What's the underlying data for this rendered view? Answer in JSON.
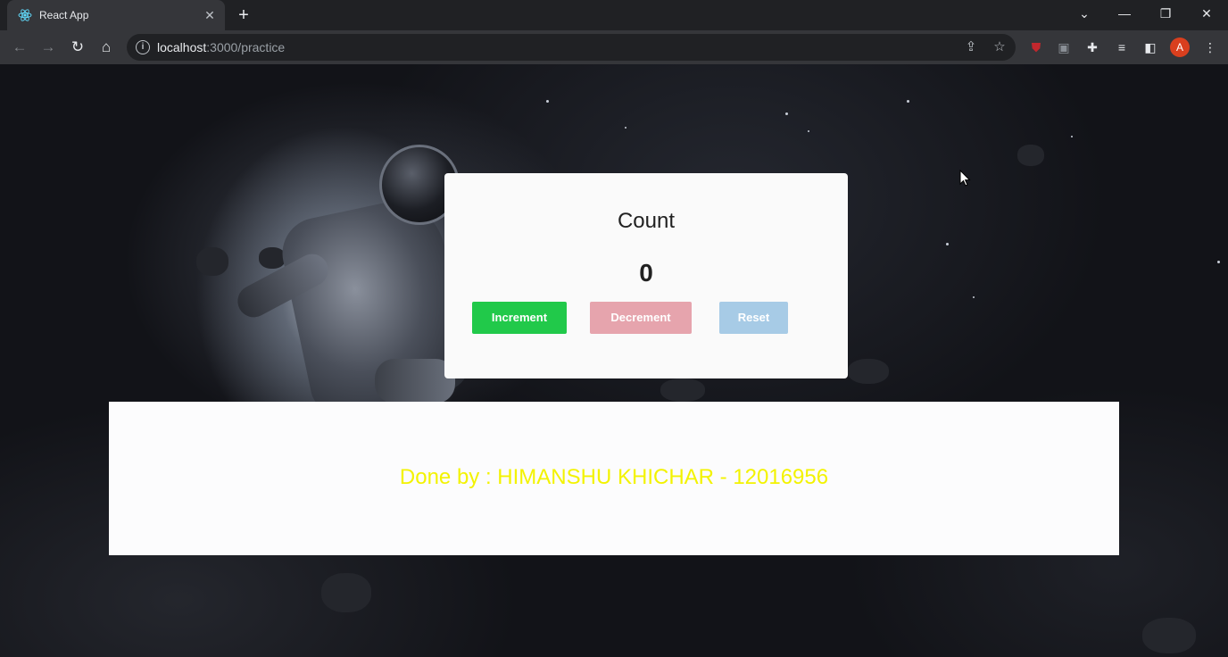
{
  "browser": {
    "tab_title": "React App",
    "tab_close": "✕",
    "new_tab": "+",
    "url_host": "localhost",
    "url_path": ":3000/practice",
    "avatar_letter": "A",
    "window_controls": {
      "minimize": "—",
      "restore": "❐",
      "close": "✕",
      "tab_search": "⌄"
    }
  },
  "counter": {
    "title": "Count",
    "value": "0",
    "buttons": {
      "increment": "Increment",
      "decrement": "Decrement",
      "reset": "Reset"
    }
  },
  "footer": {
    "text": "Done by : HIMANSHU KHICHAR - 12016956"
  },
  "colors": {
    "increment": "#21c94a",
    "decrement": "#e6a4ad",
    "reset": "#a7cbe6",
    "footer_text": "#f3f300"
  }
}
